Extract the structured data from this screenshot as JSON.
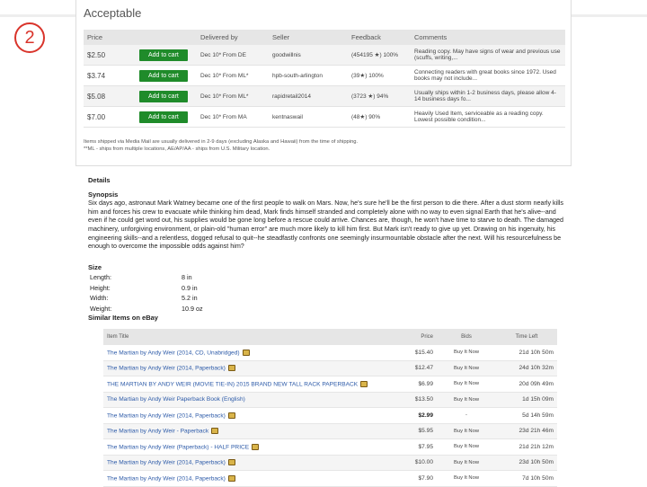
{
  "slide_number": "2",
  "offers": {
    "title": "Acceptable",
    "columns": [
      "Price",
      "",
      "Delivered by",
      "Seller",
      "Feedback",
      "Comments"
    ],
    "add_label": "Add to cart",
    "rows": [
      {
        "price": "$2.50",
        "delivered": "Dec 10* From DE",
        "seller": "goodwillnis",
        "feedback": "(454195 ★) 100%",
        "comments": "Reading copy. May have signs of wear and previous use (scuffs, writing,..."
      },
      {
        "price": "$3.74",
        "delivered": "Dec 10* From ML*",
        "seller": "hpb-south-arlington",
        "feedback": "(39★) 100%",
        "comments": "Connecting readers with great books since 1972. Used books may not include..."
      },
      {
        "price": "$5.08",
        "delivered": "Dec 10* From ML*",
        "seller": "rapidretail2014",
        "feedback": "(3723 ★) 94%",
        "comments": "Usually ships within 1-2 business days, please allow 4-14 business days fo..."
      },
      {
        "price": "$7.00",
        "delivered": "Dec 10* From MA",
        "seller": "kentnaswail",
        "feedback": "(48★) 90%",
        "comments": "Heavily Used Item, serviceable as a reading copy. Lowest possible condition..."
      }
    ],
    "note1": "Items shipped via Media Mail are usually delivered in 2-9 days (excluding Alaska and Hawaii) from the time of shipping.",
    "note2": "**ML - ships from multiple locations, AE/AP/AA - ships from U.S. Military location."
  },
  "details": {
    "heading": "Details",
    "synopsis_heading": "Synopsis",
    "synopsis": "Six days ago, astronaut Mark Watney became one of the first people to walk on Mars. Now, he's sure he'll be the first person to die there. After a dust storm nearly kills him and forces his crew to evacuate while thinking him dead, Mark finds himself stranded and completely alone with no way to even signal Earth that he's alive--and even if he could get word out, his supplies would be gone long before a rescue could arrive. Chances are, though, he won't have time to starve to death. The damaged machinery, unforgiving environment, or plain-old \"human error\" are much more likely to kill him first. But Mark isn't ready to give up yet. Drawing on his ingenuity, his engineering skills--and a relentless, dogged refusal to quit--he steadfastly confronts one seemingly insurmountable obstacle after the next. Will his resourcefulness be enough to overcome the impossible odds against him?",
    "size_heading": "Size",
    "sizes": [
      {
        "k": "Length:",
        "v": "8 in"
      },
      {
        "k": "Height:",
        "v": "0.9 in"
      },
      {
        "k": "Width:",
        "v": "5.2 in"
      },
      {
        "k": "Weight:",
        "v": "10.9 oz"
      }
    ]
  },
  "similar": {
    "heading": "Similar Items on eBay",
    "columns": [
      "Item Title",
      "Price",
      "Bids",
      "Time Left"
    ],
    "rows": [
      {
        "title": "The Martian by Andy Weir (2014, CD, Unabridged)",
        "price": "$15.40",
        "bids": "Buy It Now",
        "time": "21d 10h 50m"
      },
      {
        "title": "The Martian by Andy Weir (2014, Paperback)",
        "price": "$12.47",
        "bids": "Buy It Now",
        "time": "24d 10h 32m"
      },
      {
        "title": "THE MARTIAN BY ANDY WEIR (MOVIE TIE-IN) 2015 BRAND NEW TALL RACK PAPERBACK",
        "price": "$6.99",
        "bids": "Buy It Now",
        "time": "20d 09h 49m"
      },
      {
        "title": "The Martian by Andy Weir Paperback Book (English)",
        "price": "$13.50",
        "bids": "Buy It Now",
        "time": "1d 15h 09m"
      },
      {
        "title": "The Martian by Andy Weir (2014, Paperback)",
        "price": "$2.99",
        "bids": "-",
        "time": "5d 14h 59m"
      },
      {
        "title": "The Martian by Andy Weir - Paperback",
        "price": "$5.95",
        "bids": "Buy It Now",
        "time": "23d 21h 46m"
      },
      {
        "title": "The Martian by Andy Weir (Paperback) - HALF PRICE",
        "price": "$7.95",
        "bids": "Buy It Now",
        "time": "21d 21h 12m"
      },
      {
        "title": "The Martian by Andy Weir (2014, Paperback)",
        "price": "$10.00",
        "bids": "Buy It Now",
        "time": "23d 10h 50m"
      },
      {
        "title": "The Martian by Andy Weir (2014, Paperback)",
        "price": "$7.90",
        "bids": "Buy It Now",
        "time": "7d 10h 50m"
      }
    ]
  },
  "colors": {
    "accent_green": "#1f8b2a",
    "link_blue": "#2c5aa8",
    "badge_red": "#d9342b"
  }
}
